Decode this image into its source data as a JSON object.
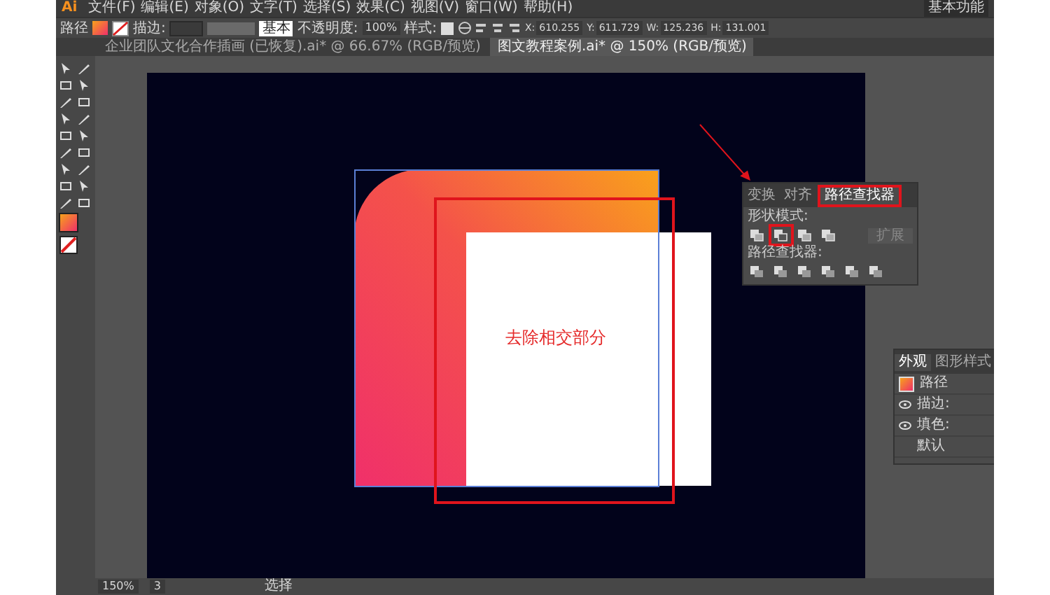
{
  "app": {
    "logo": "Ai",
    "workspace": "基本功能",
    "menu": [
      "文件(F)",
      "编辑(E)",
      "对象(O)",
      "文字(T)",
      "选择(S)",
      "效果(C)",
      "视图(V)",
      "窗口(W)",
      "帮助(H)"
    ]
  },
  "control_bar": {
    "object_type": "路径",
    "stroke_label": "描边:",
    "stroke_profile": "基本",
    "opacity_label": "不透明度:",
    "opacity": "100%",
    "style_label": "样式:",
    "fields": [
      {
        "label": "X:",
        "value": "610.255"
      },
      {
        "label": "Y:",
        "value": "611.729"
      },
      {
        "label": "W:",
        "value": "125.236"
      },
      {
        "label": "H:",
        "value": "131.001"
      }
    ]
  },
  "doc_tabs": [
    {
      "label": "企业团队文化合作插画 (已恢复).ai* @ 66.67% (RGB/预览)",
      "selected": false
    },
    {
      "label": "图文教程案例.ai* @ 150% (RGB/预览)",
      "selected": true
    }
  ],
  "canvas": {
    "annotation": "去除相交部分"
  },
  "pathfinder_panel": {
    "tabs": [
      {
        "label": "变换",
        "selected": false
      },
      {
        "label": "对齐",
        "selected": false
      },
      {
        "label": "路径查找器",
        "selected": true
      }
    ],
    "shape_modes_label": "形状模式:",
    "shape_modes": [
      {
        "selected": false
      },
      {
        "selected": true
      },
      {
        "selected": false
      },
      {
        "selected": false
      }
    ],
    "expand_button": "扩展",
    "pathfinders_label": "路径查找器:"
  },
  "appearance_panel": {
    "tabs": [
      {
        "label": "外观",
        "selected": true
      },
      {
        "label": "图形样式",
        "selected": false
      }
    ],
    "rows": [
      {
        "kind": "object",
        "label": "路径"
      },
      {
        "kind": "stroke",
        "label": "描边:"
      },
      {
        "kind": "fill",
        "label": "填色:"
      },
      {
        "kind": "plain",
        "label": "默认"
      }
    ]
  },
  "status_bar": {
    "zoom": "150%",
    "artboard": "3",
    "tool": "选择"
  }
}
